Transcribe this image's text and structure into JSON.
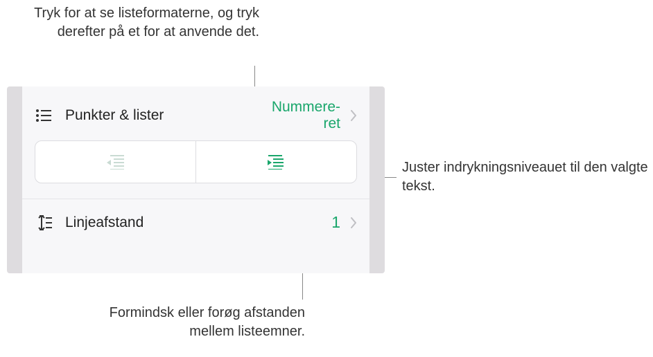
{
  "callouts": {
    "top": "Tryk for at se listeformaterne, og tryk derefter på et for at anvende det.",
    "right": "Juster indrykningsniveauet til den valgte tekst.",
    "bottom": "Formindsk eller forøg afstanden mellem listeemner."
  },
  "panel": {
    "bullets": {
      "label": "Punkter & lister",
      "value": "Nummere-\nret"
    },
    "linespacing": {
      "label": "Linjeafstand",
      "value": "1"
    }
  }
}
